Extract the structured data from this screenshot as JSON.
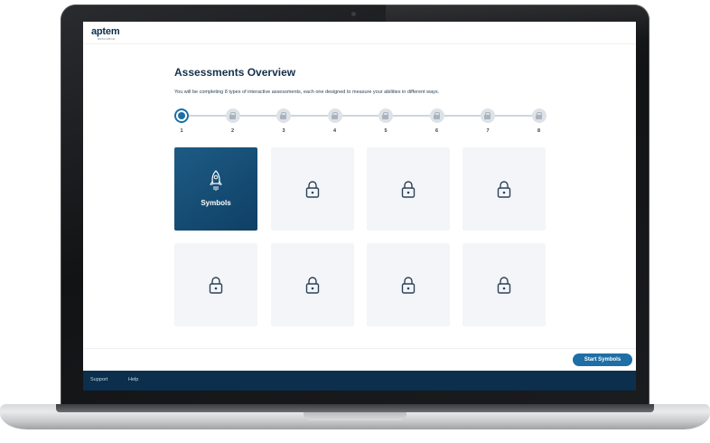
{
  "header": {
    "logo": "aptem",
    "logo_sub": "RESOURCE"
  },
  "main": {
    "title": "Assessments Overview",
    "subtitle": "You will be completing 8 types of interactive assessments, each one designed to measure your abilities in different ways."
  },
  "stepper": {
    "steps": [
      "1",
      "2",
      "3",
      "4",
      "5",
      "6",
      "7",
      "8"
    ],
    "current_step": 1
  },
  "cards": [
    {
      "label": "Symbols",
      "state": "active",
      "icon": "rocket-icon"
    },
    {
      "label": "",
      "state": "locked",
      "icon": "lock-icon"
    },
    {
      "label": "",
      "state": "locked",
      "icon": "lock-icon"
    },
    {
      "label": "",
      "state": "locked",
      "icon": "lock-icon"
    },
    {
      "label": "",
      "state": "locked",
      "icon": "lock-icon"
    },
    {
      "label": "",
      "state": "locked",
      "icon": "lock-icon"
    },
    {
      "label": "",
      "state": "locked",
      "icon": "lock-icon"
    },
    {
      "label": "",
      "state": "locked",
      "icon": "lock-icon"
    }
  ],
  "actions": {
    "start_label": "Start Symbols"
  },
  "footer": {
    "links": [
      "Support",
      "Help"
    ]
  },
  "colors": {
    "brand_dark": "#0b2f4d",
    "accent": "#1d6fa5",
    "card_active": "#1d5b85",
    "card_locked": "#f3f5f8"
  }
}
